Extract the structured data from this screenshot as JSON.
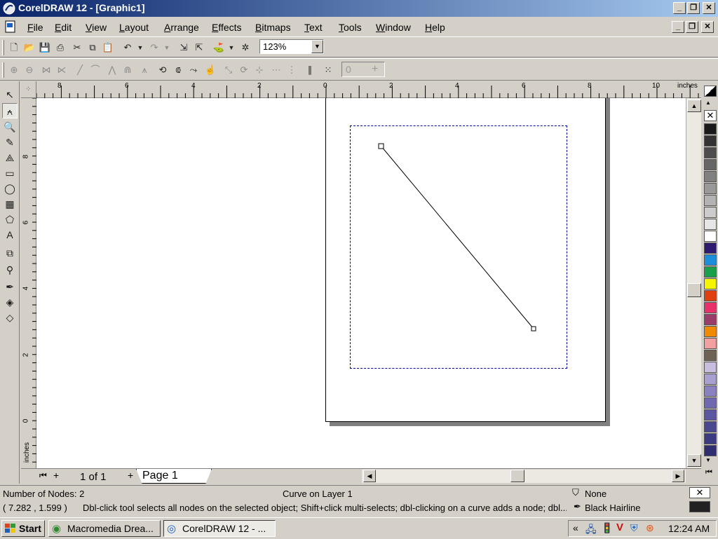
{
  "window": {
    "title": "CorelDRAW 12 - [Graphic1]"
  },
  "menu": {
    "items": [
      {
        "label": "File"
      },
      {
        "label": "Edit"
      },
      {
        "label": "View"
      },
      {
        "label": "Layout"
      },
      {
        "label": "Arrange"
      },
      {
        "label": "Effects"
      },
      {
        "label": "Bitmaps"
      },
      {
        "label": "Text"
      },
      {
        "label": "Tools"
      },
      {
        "label": "Window"
      },
      {
        "label": "Help"
      }
    ]
  },
  "toolbar": {
    "zoom_level": "123%",
    "nudge_value": "0"
  },
  "rulers": {
    "unit": "inches",
    "h_ticks": [
      "8",
      "6",
      "4",
      "2",
      "0",
      "2",
      "4",
      "6",
      "8",
      "10"
    ],
    "v_ticks": [
      "8",
      "6",
      "4",
      "2",
      "0"
    ],
    "v_unit": "inches"
  },
  "document": {
    "page_counter": "1 of 1",
    "page_tab": "Page 1"
  },
  "palette": {
    "colors": [
      "#1a1a1a",
      "#333333",
      "#4d4d4d",
      "#666666",
      "#808080",
      "#999999",
      "#b3b3b3",
      "#cccccc",
      "#e6e6e6",
      "#ffffff",
      "#2e1a6e",
      "#1b8fd9",
      "#1aa04a",
      "#f5f500",
      "#e04010",
      "#e8306a",
      "#9a3c6a",
      "#f08a00",
      "#f2a0a0",
      "#6e6254",
      "#c8bfe0",
      "#a8a0d0",
      "#8a82c0",
      "#7068b0",
      "#5a56a0",
      "#4a4890",
      "#3c3a80",
      "#302e70"
    ]
  },
  "status": {
    "nodes": "Number of Nodes: 2",
    "object_info": "Curve on Layer 1",
    "coords": "( 7.282 , 1.599 )",
    "hint": "Dbl-click tool selects all nodes on the selected object; Shift+click multi-selects; dbl-clicking on a curve adds a node; dbl...",
    "fill_label": "None",
    "outline_label": "Black  Hairline"
  },
  "taskbar": {
    "start_label": "Start",
    "tasks": [
      {
        "label": "Macromedia Drea..."
      },
      {
        "label": "CorelDRAW 12 - ..."
      }
    ],
    "clock": "12:24 AM",
    "tray_chevron": "«"
  }
}
